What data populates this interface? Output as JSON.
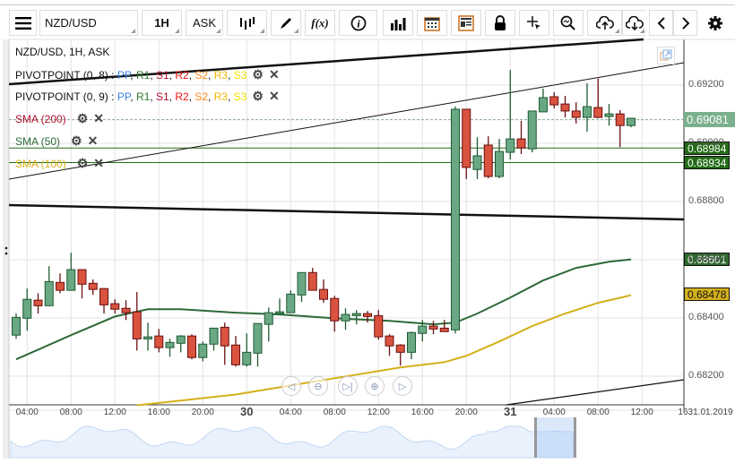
{
  "toolbar": {
    "symbol": "NZD/USD",
    "timeframe": "1H",
    "price_type": "ASK",
    "buttons": [
      "menu-icon",
      "chart-type-icon",
      "draw-icon",
      "function-icon",
      "info-icon",
      "bar-chart-icon",
      "calendar-icon",
      "report-icon",
      "lock-icon",
      "crosshair-icon",
      "zoom-search-icon",
      "upload-icon",
      "download-icon",
      "chevron-left-icon",
      "chevron-right-icon",
      "gear-icon"
    ],
    "fx_label": "f(x)",
    "info_label": "i"
  },
  "legend": {
    "title": "NZD/USD, 1H, ASK",
    "pivot1": "PIVOTPOINT (0, 8)",
    "pivot2": "PIVOTPOINT (0, 9)",
    "pivot_sep": " : ",
    "pivot_levels": [
      {
        "label": "PP",
        "color": "#3a7fe0"
      },
      {
        "label": "R1",
        "color": "#2a7a2a"
      },
      {
        "label": "S1",
        "color": "#b01030"
      },
      {
        "label": "R2",
        "color": "#ee1111"
      },
      {
        "label": "S2",
        "color": "#ff8c1a"
      },
      {
        "label": "R3",
        "color": "#f2b400"
      },
      {
        "label": "S3",
        "color": "#f5e000"
      }
    ],
    "sma200": "SMA (200)",
    "sma50": "SMA (50)",
    "sma100": "SMA (100)",
    "sma200_color": "#b01030",
    "sma50_color": "#2d6a3a",
    "sma100_color": "#d4b01c"
  },
  "colors": {
    "up": "#6aa884",
    "down": "#d9533f",
    "up_border": "#1f5a32",
    "down_border": "#6a1010",
    "grid": "#e3e3e3"
  },
  "price_labels": {
    "current": "0.69081",
    "line1": "0.68984",
    "line2": "0.68934",
    "sma50": "0.68601",
    "sma100": "0.68478"
  },
  "chart_data": {
    "type": "candlestick",
    "symbol": "NZD/USD",
    "y_ticks": [
      "0.69200",
      "0.69000",
      "0.68800",
      "0.68600",
      "0.68400",
      "0.68200"
    ],
    "x_ticks": [
      {
        "t": "29 04:00",
        "label": "04:00"
      },
      {
        "t": "29 08:00",
        "label": "08:00"
      },
      {
        "t": "29 12:00",
        "label": "12:00"
      },
      {
        "t": "29 16:00",
        "label": "16:00"
      },
      {
        "t": "29 20:00",
        "label": "20:00"
      },
      {
        "t": "30 00:00",
        "label": "30",
        "day": true
      },
      {
        "t": "30 04:00",
        "label": "04:00"
      },
      {
        "t": "30 08:00",
        "label": "08:00"
      },
      {
        "t": "30 12:00",
        "label": "12:00"
      },
      {
        "t": "30 16:00",
        "label": "16:00"
      },
      {
        "t": "30 20:00",
        "label": "20:00"
      },
      {
        "t": "31 00:00",
        "label": "31",
        "day": true
      },
      {
        "t": "31 04:00",
        "label": "04:00"
      },
      {
        "t": "31 08:00",
        "label": "08:00"
      },
      {
        "t": "31 12:00",
        "label": "12:00"
      },
      {
        "t": "31 16:00",
        "label": "1631.01.2019"
      }
    ],
    "horizontal_lines": [
      0.68984,
      0.68934
    ],
    "current_price": 0.69081,
    "candles_ohlc": [
      [
        "29 03:00",
        0.68341,
        0.68415,
        0.68328,
        0.68402
      ],
      [
        "29 04:00",
        0.68399,
        0.68501,
        0.68356,
        0.68464
      ],
      [
        "29 05:00",
        0.68461,
        0.68485,
        0.68415,
        0.68442
      ],
      [
        "29 06:00",
        0.68442,
        0.68578,
        0.68442,
        0.68525
      ],
      [
        "29 07:00",
        0.68522,
        0.68553,
        0.68485,
        0.68495
      ],
      [
        "29 08:00",
        0.68495,
        0.68624,
        0.68495,
        0.68566
      ],
      [
        "29 09:00",
        0.68566,
        0.68566,
        0.68467,
        0.68516
      ],
      [
        "29 10:00",
        0.68519,
        0.68532,
        0.68479,
        0.68498
      ],
      [
        "29 11:00",
        0.68501,
        0.68501,
        0.68415,
        0.68445
      ],
      [
        "29 12:00",
        0.68449,
        0.68464,
        0.68415,
        0.6843
      ],
      [
        "29 13:00",
        0.68433,
        0.68461,
        0.68393,
        0.68418
      ],
      [
        "29 14:00",
        0.68421,
        0.68489,
        0.68288,
        0.68328
      ],
      [
        "29 15:00",
        0.68328,
        0.68384,
        0.68288,
        0.68335
      ],
      [
        "29 16:00",
        0.68338,
        0.68362,
        0.68282,
        0.68298
      ],
      [
        "29 17:00",
        0.68298,
        0.68328,
        0.68267,
        0.68316
      ],
      [
        "29 18:00",
        0.68313,
        0.68341,
        0.68282,
        0.68338
      ],
      [
        "29 19:00",
        0.68338,
        0.68344,
        0.68258,
        0.68264
      ],
      [
        "29 20:00",
        0.68264,
        0.68319,
        0.68251,
        0.6831
      ],
      [
        "29 21:00",
        0.6831,
        0.68365,
        0.68288,
        0.68365
      ],
      [
        "29 22:00",
        0.68368,
        0.68384,
        0.68239,
        0.68304
      ],
      [
        "29 23:00",
        0.68307,
        0.68338,
        0.68233,
        0.68239
      ],
      [
        "30 00:00",
        0.68239,
        0.68347,
        0.68233,
        0.68282
      ],
      [
        "30 01:00",
        0.68279,
        0.68381,
        0.68233,
        0.68381
      ],
      [
        "30 02:00",
        0.68378,
        0.68436,
        0.68319,
        0.68418
      ],
      [
        "30 03:00",
        0.68415,
        0.68467,
        0.68415,
        0.68421
      ],
      [
        "30 04:00",
        0.68418,
        0.68495,
        0.68418,
        0.68482
      ],
      [
        "30 05:00",
        0.68479,
        0.68556,
        0.68455,
        0.68556
      ],
      [
        "30 06:00",
        0.68556,
        0.68572,
        0.68495,
        0.68495
      ],
      [
        "30 07:00",
        0.68498,
        0.68532,
        0.68452,
        0.68464
      ],
      [
        "30 08:00",
        0.68467,
        0.68476,
        0.68353,
        0.6839
      ],
      [
        "30 09:00",
        0.6839,
        0.68433,
        0.68359,
        0.68412
      ],
      [
        "30 10:00",
        0.68408,
        0.68427,
        0.68378,
        0.68415
      ],
      [
        "30 11:00",
        0.68415,
        0.68424,
        0.68384,
        0.68405
      ],
      [
        "30 12:00",
        0.68408,
        0.68427,
        0.68325,
        0.68335
      ],
      [
        "30 13:00",
        0.68338,
        0.68344,
        0.6827,
        0.68304
      ],
      [
        "30 14:00",
        0.68307,
        0.6831,
        0.68236,
        0.68282
      ],
      [
        "30 15:00",
        0.68282,
        0.68353,
        0.68258,
        0.6835
      ],
      [
        "30 16:00",
        0.68347,
        0.68393,
        0.68319,
        0.68372
      ],
      [
        "30 17:00",
        0.68372,
        0.6839,
        0.68344,
        0.68362
      ],
      [
        "30 18:00",
        0.68365,
        0.68393,
        0.68353,
        0.68353
      ],
      [
        "30 19:00",
        0.68359,
        0.69126,
        0.68347,
        0.69117
      ],
      [
        "30 20:00",
        0.69117,
        0.69117,
        0.68877,
        0.68917
      ],
      [
        "30 21:00",
        0.6891,
        0.69021,
        0.68877,
        0.68957
      ],
      [
        "30 22:00",
        0.68994,
        0.69024,
        0.6888,
        0.68886
      ],
      [
        "30 23:00",
        0.68886,
        0.69015,
        0.6888,
        0.68972
      ],
      [
        "31 00:00",
        0.68969,
        0.69252,
        0.68944,
        0.69015
      ],
      [
        "31 01:00",
        0.69015,
        0.69077,
        0.68963,
        0.68984
      ],
      [
        "31 02:00",
        0.68981,
        0.69111,
        0.68969,
        0.69111
      ],
      [
        "31 03:00",
        0.69108,
        0.69188,
        0.69108,
        0.69157
      ],
      [
        "31 04:00",
        0.6916,
        0.69175,
        0.6912,
        0.69132
      ],
      [
        "31 05:00",
        0.69135,
        0.69163,
        0.69089,
        0.69111
      ],
      [
        "31 06:00",
        0.69111,
        0.69141,
        0.69068,
        0.69089
      ],
      [
        "31 07:00",
        0.69089,
        0.69206,
        0.6904,
        0.69126
      ],
      [
        "31 08:00",
        0.69123,
        0.69222,
        0.69086,
        0.69089
      ],
      [
        "31 09:00",
        0.69092,
        0.69135,
        0.69061,
        0.69101
      ],
      [
        "31 10:00",
        0.69101,
        0.69114,
        0.68987,
        0.69061
      ],
      [
        "31 11:00",
        0.69061,
        0.69086,
        0.69055,
        0.69086
      ]
    ],
    "sma50": [
      [
        "29 03:00",
        0.68258
      ],
      [
        "29 05:00",
        0.68291
      ],
      [
        "29 08:00",
        0.68341
      ],
      [
        "29 12:00",
        0.68405
      ],
      [
        "29 15:00",
        0.6843
      ],
      [
        "29 18:00",
        0.6843
      ],
      [
        "29 23:00",
        0.68418
      ],
      [
        "30 03:00",
        0.68412
      ],
      [
        "30 08:00",
        0.68399
      ],
      [
        "30 13:00",
        0.6839
      ],
      [
        "30 17:00",
        0.68378
      ],
      [
        "30 19:00",
        0.68384
      ],
      [
        "30 21:00",
        0.68415
      ],
      [
        "31 00:00",
        0.6847
      ],
      [
        "31 03:00",
        0.68529
      ],
      [
        "31 06:00",
        0.68572
      ],
      [
        "31 09:00",
        0.68593
      ],
      [
        "31 11:00",
        0.68601
      ]
    ],
    "sma100": [
      [
        "29 14:00",
        0.681
      ],
      [
        "29 18:00",
        0.68116
      ],
      [
        "29 23:00",
        0.68137
      ],
      [
        "30 04:00",
        0.68168
      ],
      [
        "30 09:00",
        0.68199
      ],
      [
        "30 14:00",
        0.6823
      ],
      [
        "30 18:00",
        0.68248
      ],
      [
        "30 20:00",
        0.6827
      ],
      [
        "30 23:00",
        0.68319
      ],
      [
        "31 02:00",
        0.68372
      ],
      [
        "31 05:00",
        0.68415
      ],
      [
        "31 08:00",
        0.68452
      ],
      [
        "31 11:00",
        0.68478
      ]
    ]
  }
}
